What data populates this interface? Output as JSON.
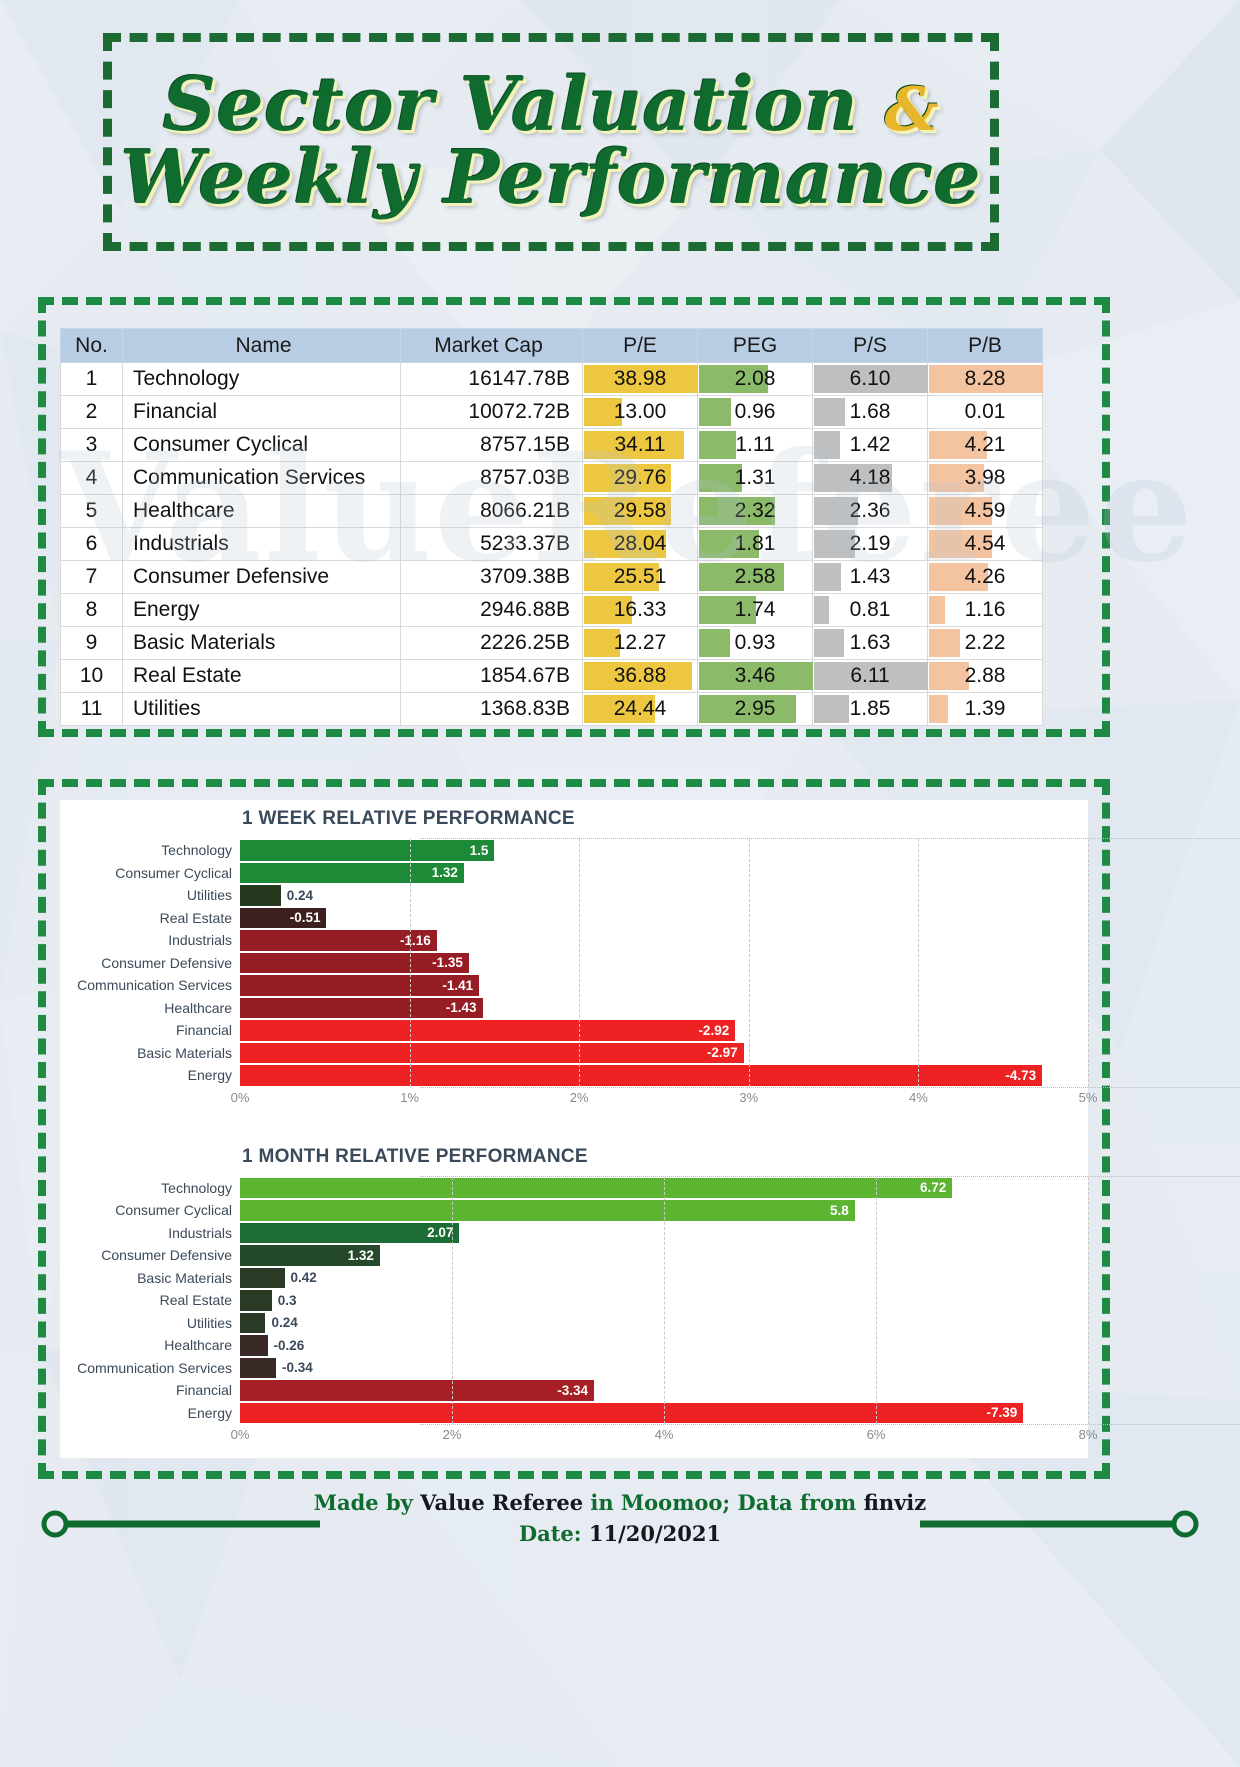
{
  "title": {
    "line1_a": "Sector Valuation ",
    "line1_amp": "&",
    "line2": "Weekly Performance"
  },
  "watermark": "ValueReferee",
  "colors": {
    "brand_green": "#0f6b2e",
    "frame_green": "#1f8a43",
    "header_blue": "#b8cce4",
    "pe_bar": "#ecc73f",
    "peg_bar": "#8bba69",
    "ps_bar": "#bfbfbf",
    "pb_bar": "#f4c3a0",
    "bar_bright_green": "#5cb531",
    "bar_dark_green": "#2b4d2b",
    "bar_mid_green": "#1d7a3a",
    "bar_bright_red": "#ee2222",
    "bar_dark_red": "#3a2626",
    "bar_mid_red": "#9c1f22"
  },
  "table": {
    "headers": [
      "No.",
      "Name",
      "Market Cap",
      "P/E",
      "PEG",
      "P/S",
      "P/B"
    ],
    "rows": [
      {
        "no": "1",
        "name": "Technology",
        "cap": "16147.78B",
        "pe": "38.98",
        "peg": "2.08",
        "ps": "6.10",
        "pb": "8.28"
      },
      {
        "no": "2",
        "name": "Financial",
        "cap": "10072.72B",
        "pe": "13.00",
        "peg": "0.96",
        "ps": "1.68",
        "pb": "0.01"
      },
      {
        "no": "3",
        "name": "Consumer Cyclical",
        "cap": "8757.15B",
        "pe": "34.11",
        "peg": "1.11",
        "ps": "1.42",
        "pb": "4.21"
      },
      {
        "no": "4",
        "name": "Communication Services",
        "cap": "8757.03B",
        "pe": "29.76",
        "peg": "1.31",
        "ps": "4.18",
        "pb": "3.98"
      },
      {
        "no": "5",
        "name": "Healthcare",
        "cap": "8066.21B",
        "pe": "29.58",
        "peg": "2.32",
        "ps": "2.36",
        "pb": "4.59"
      },
      {
        "no": "6",
        "name": "Industrials",
        "cap": "5233.37B",
        "pe": "28.04",
        "peg": "1.81",
        "ps": "2.19",
        "pb": "4.54"
      },
      {
        "no": "7",
        "name": "Consumer Defensive",
        "cap": "3709.38B",
        "pe": "25.51",
        "peg": "2.58",
        "ps": "1.43",
        "pb": "4.26"
      },
      {
        "no": "8",
        "name": "Energy",
        "cap": "2946.88B",
        "pe": "16.33",
        "peg": "1.74",
        "ps": "0.81",
        "pb": "1.16"
      },
      {
        "no": "9",
        "name": "Basic Materials",
        "cap": "2226.25B",
        "pe": "12.27",
        "peg": "0.93",
        "ps": "1.63",
        "pb": "2.22"
      },
      {
        "no": "10",
        "name": "Real Estate",
        "cap": "1854.67B",
        "pe": "36.88",
        "peg": "3.46",
        "ps": "6.11",
        "pb": "2.88"
      },
      {
        "no": "11",
        "name": "Utilities",
        "cap": "1368.83B",
        "pe": "24.44",
        "peg": "2.95",
        "ps": "1.85",
        "pb": "1.39"
      }
    ]
  },
  "chart_data": [
    {
      "type": "bar",
      "orientation": "horizontal",
      "title": "1 WEEK RELATIVE PERFORMANCE",
      "xlabel": "",
      "ylabel": "",
      "xlim": [
        0,
        5
      ],
      "xticks": [
        "0%",
        "1%",
        "2%",
        "3%",
        "4%",
        "5%"
      ],
      "grid": true,
      "note": "bars drawn by absolute magnitude; sign shown in label",
      "categories": [
        "Technology",
        "Consumer Cyclical",
        "Utilities",
        "Real Estate",
        "Industrials",
        "Consumer Defensive",
        "Communication Services",
        "Healthcare",
        "Financial",
        "Basic Materials",
        "Energy"
      ],
      "values": [
        1.5,
        1.32,
        0.24,
        -0.51,
        -1.16,
        -1.35,
        -1.41,
        -1.43,
        -2.92,
        -2.97,
        -4.73
      ],
      "labels": [
        "1.5",
        "1.32",
        "0.24",
        "-0.51",
        "-1.16",
        "-1.35",
        "-1.41",
        "-1.43",
        "-2.92",
        "-2.97",
        "-4.73"
      ],
      "bar_colors": [
        "#1d8a38",
        "#1d8a38",
        "#25391f",
        "#3d1f1f",
        "#951d23",
        "#951d23",
        "#951d23",
        "#951d23",
        "#ee2222",
        "#ee2222",
        "#ee2222"
      ],
      "label_inside": [
        true,
        true,
        false,
        true,
        true,
        true,
        true,
        true,
        true,
        true,
        true
      ]
    },
    {
      "type": "bar",
      "orientation": "horizontal",
      "title": "1 MONTH RELATIVE PERFORMANCE",
      "xlabel": "",
      "ylabel": "",
      "xlim": [
        0,
        8
      ],
      "xticks": [
        "0%",
        "2%",
        "4%",
        "6%",
        "8%"
      ],
      "grid": true,
      "note": "bars drawn by absolute magnitude; sign shown in label",
      "categories": [
        "Technology",
        "Consumer Cyclical",
        "Industrials",
        "Consumer Defensive",
        "Basic Materials",
        "Real Estate",
        "Utilities",
        "Healthcare",
        "Communication Services",
        "Financial",
        "Energy"
      ],
      "values": [
        6.72,
        5.8,
        2.07,
        1.32,
        0.42,
        0.3,
        0.24,
        -0.26,
        -0.34,
        -3.34,
        -7.39
      ],
      "labels": [
        "6.72",
        "5.8",
        "2.07",
        "1.32",
        "0.42",
        "0.3",
        "0.24",
        "-0.26",
        "-0.34",
        "-3.34",
        "-7.39"
      ],
      "bar_colors": [
        "#5cb531",
        "#5cb531",
        "#1d6b35",
        "#254a2b",
        "#2b3a25",
        "#2b3a25",
        "#2b3a25",
        "#3a2a27",
        "#3a2a27",
        "#a51f24",
        "#ee2222"
      ],
      "label_inside": [
        true,
        true,
        true,
        true,
        false,
        false,
        false,
        false,
        false,
        true,
        true
      ]
    }
  ],
  "footer": {
    "made_by_prefix": "Made by ",
    "made_by_name": "Value Referee",
    "in_platform": " in Moomoo; Data from ",
    "source": "finviz",
    "date_label": "Date: ",
    "date_value": "11/20/2021"
  }
}
